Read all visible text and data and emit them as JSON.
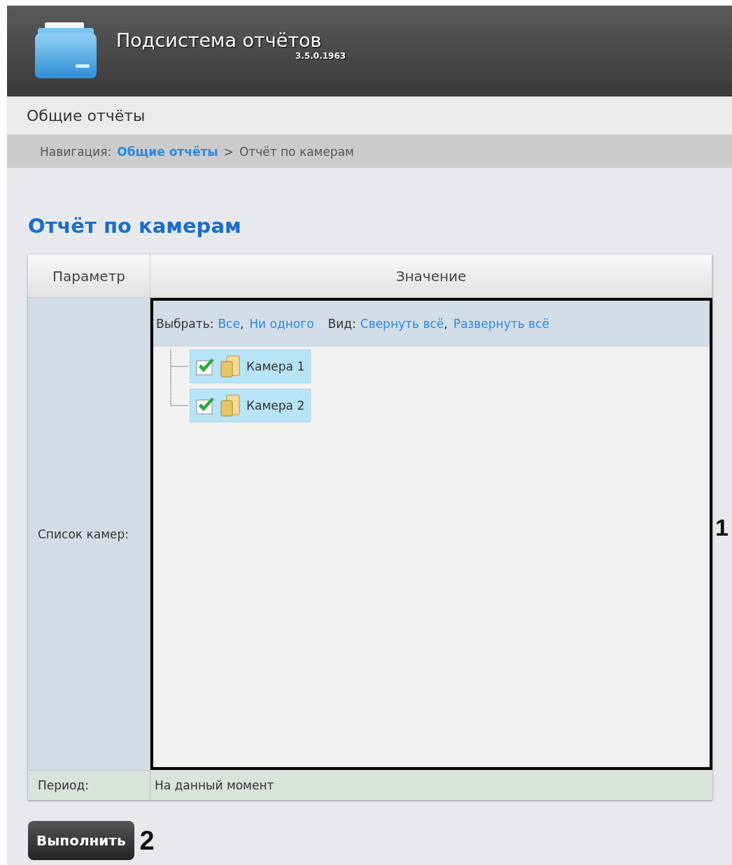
{
  "header": {
    "title": "Подсистема отчётов",
    "version": "3.5.0.1963"
  },
  "section": "Общие отчёты",
  "breadcrumb": {
    "label": "Навигация:",
    "link": "Общие отчёты",
    "separator": ">",
    "current": "Отчёт по камерам"
  },
  "page_title": "Отчёт по камерам",
  "table": {
    "columns": [
      "Параметр",
      "Значение"
    ],
    "camera_row": {
      "label": "Список камер:",
      "select_label": "Выбрать:",
      "select_links": [
        "Все",
        "Ни одного"
      ],
      "view_label": "Вид:",
      "view_links": [
        "Свернуть всё",
        "Развернуть всё"
      ],
      "link_separator": ",",
      "cameras": [
        {
          "name": "Камера 1",
          "checked": true
        },
        {
          "name": "Камера 2",
          "checked": true
        }
      ]
    },
    "period_row": {
      "label": "Период:",
      "value": "На данный момент"
    }
  },
  "button": "Выполнить",
  "callouts": [
    "1",
    "2"
  ]
}
